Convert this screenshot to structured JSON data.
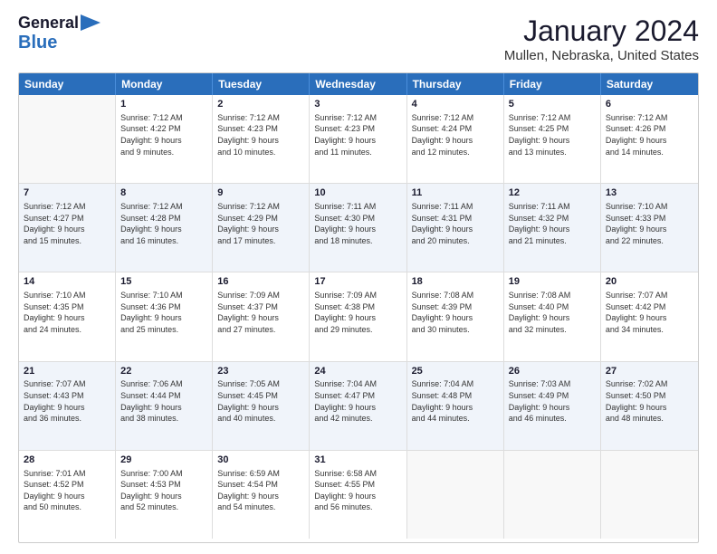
{
  "header": {
    "logo_line1": "General",
    "logo_line2": "Blue",
    "title": "January 2024",
    "subtitle": "Mullen, Nebraska, United States"
  },
  "calendar": {
    "days_of_week": [
      "Sunday",
      "Monday",
      "Tuesday",
      "Wednesday",
      "Thursday",
      "Friday",
      "Saturday"
    ],
    "rows": [
      [
        {
          "day": "",
          "sunrise": "",
          "sunset": "",
          "daylight": "",
          "empty": true
        },
        {
          "day": "1",
          "sunrise": "Sunrise: 7:12 AM",
          "sunset": "Sunset: 4:22 PM",
          "daylight": "Daylight: 9 hours and 9 minutes."
        },
        {
          "day": "2",
          "sunrise": "Sunrise: 7:12 AM",
          "sunset": "Sunset: 4:23 PM",
          "daylight": "Daylight: 9 hours and 10 minutes."
        },
        {
          "day": "3",
          "sunrise": "Sunrise: 7:12 AM",
          "sunset": "Sunset: 4:23 PM",
          "daylight": "Daylight: 9 hours and 11 minutes."
        },
        {
          "day": "4",
          "sunrise": "Sunrise: 7:12 AM",
          "sunset": "Sunset: 4:24 PM",
          "daylight": "Daylight: 9 hours and 12 minutes."
        },
        {
          "day": "5",
          "sunrise": "Sunrise: 7:12 AM",
          "sunset": "Sunset: 4:25 PM",
          "daylight": "Daylight: 9 hours and 13 minutes."
        },
        {
          "day": "6",
          "sunrise": "Sunrise: 7:12 AM",
          "sunset": "Sunset: 4:26 PM",
          "daylight": "Daylight: 9 hours and 14 minutes."
        }
      ],
      [
        {
          "day": "7",
          "sunrise": "Sunrise: 7:12 AM",
          "sunset": "Sunset: 4:27 PM",
          "daylight": "Daylight: 9 hours and 15 minutes."
        },
        {
          "day": "8",
          "sunrise": "Sunrise: 7:12 AM",
          "sunset": "Sunset: 4:28 PM",
          "daylight": "Daylight: 9 hours and 16 minutes."
        },
        {
          "day": "9",
          "sunrise": "Sunrise: 7:12 AM",
          "sunset": "Sunset: 4:29 PM",
          "daylight": "Daylight: 9 hours and 17 minutes."
        },
        {
          "day": "10",
          "sunrise": "Sunrise: 7:11 AM",
          "sunset": "Sunset: 4:30 PM",
          "daylight": "Daylight: 9 hours and 18 minutes."
        },
        {
          "day": "11",
          "sunrise": "Sunrise: 7:11 AM",
          "sunset": "Sunset: 4:31 PM",
          "daylight": "Daylight: 9 hours and 20 minutes."
        },
        {
          "day": "12",
          "sunrise": "Sunrise: 7:11 AM",
          "sunset": "Sunset: 4:32 PM",
          "daylight": "Daylight: 9 hours and 21 minutes."
        },
        {
          "day": "13",
          "sunrise": "Sunrise: 7:10 AM",
          "sunset": "Sunset: 4:33 PM",
          "daylight": "Daylight: 9 hours and 22 minutes."
        }
      ],
      [
        {
          "day": "14",
          "sunrise": "Sunrise: 7:10 AM",
          "sunset": "Sunset: 4:35 PM",
          "daylight": "Daylight: 9 hours and 24 minutes."
        },
        {
          "day": "15",
          "sunrise": "Sunrise: 7:10 AM",
          "sunset": "Sunset: 4:36 PM",
          "daylight": "Daylight: 9 hours and 25 minutes."
        },
        {
          "day": "16",
          "sunrise": "Sunrise: 7:09 AM",
          "sunset": "Sunset: 4:37 PM",
          "daylight": "Daylight: 9 hours and 27 minutes."
        },
        {
          "day": "17",
          "sunrise": "Sunrise: 7:09 AM",
          "sunset": "Sunset: 4:38 PM",
          "daylight": "Daylight: 9 hours and 29 minutes."
        },
        {
          "day": "18",
          "sunrise": "Sunrise: 7:08 AM",
          "sunset": "Sunset: 4:39 PM",
          "daylight": "Daylight: 9 hours and 30 minutes."
        },
        {
          "day": "19",
          "sunrise": "Sunrise: 7:08 AM",
          "sunset": "Sunset: 4:40 PM",
          "daylight": "Daylight: 9 hours and 32 minutes."
        },
        {
          "day": "20",
          "sunrise": "Sunrise: 7:07 AM",
          "sunset": "Sunset: 4:42 PM",
          "daylight": "Daylight: 9 hours and 34 minutes."
        }
      ],
      [
        {
          "day": "21",
          "sunrise": "Sunrise: 7:07 AM",
          "sunset": "Sunset: 4:43 PM",
          "daylight": "Daylight: 9 hours and 36 minutes."
        },
        {
          "day": "22",
          "sunrise": "Sunrise: 7:06 AM",
          "sunset": "Sunset: 4:44 PM",
          "daylight": "Daylight: 9 hours and 38 minutes."
        },
        {
          "day": "23",
          "sunrise": "Sunrise: 7:05 AM",
          "sunset": "Sunset: 4:45 PM",
          "daylight": "Daylight: 9 hours and 40 minutes."
        },
        {
          "day": "24",
          "sunrise": "Sunrise: 7:04 AM",
          "sunset": "Sunset: 4:47 PM",
          "daylight": "Daylight: 9 hours and 42 minutes."
        },
        {
          "day": "25",
          "sunrise": "Sunrise: 7:04 AM",
          "sunset": "Sunset: 4:48 PM",
          "daylight": "Daylight: 9 hours and 44 minutes."
        },
        {
          "day": "26",
          "sunrise": "Sunrise: 7:03 AM",
          "sunset": "Sunset: 4:49 PM",
          "daylight": "Daylight: 9 hours and 46 minutes."
        },
        {
          "day": "27",
          "sunrise": "Sunrise: 7:02 AM",
          "sunset": "Sunset: 4:50 PM",
          "daylight": "Daylight: 9 hours and 48 minutes."
        }
      ],
      [
        {
          "day": "28",
          "sunrise": "Sunrise: 7:01 AM",
          "sunset": "Sunset: 4:52 PM",
          "daylight": "Daylight: 9 hours and 50 minutes."
        },
        {
          "day": "29",
          "sunrise": "Sunrise: 7:00 AM",
          "sunset": "Sunset: 4:53 PM",
          "daylight": "Daylight: 9 hours and 52 minutes."
        },
        {
          "day": "30",
          "sunrise": "Sunrise: 6:59 AM",
          "sunset": "Sunset: 4:54 PM",
          "daylight": "Daylight: 9 hours and 54 minutes."
        },
        {
          "day": "31",
          "sunrise": "Sunrise: 6:58 AM",
          "sunset": "Sunset: 4:55 PM",
          "daylight": "Daylight: 9 hours and 56 minutes."
        },
        {
          "day": "",
          "sunrise": "",
          "sunset": "",
          "daylight": "",
          "empty": true
        },
        {
          "day": "",
          "sunrise": "",
          "sunset": "",
          "daylight": "",
          "empty": true
        },
        {
          "day": "",
          "sunrise": "",
          "sunset": "",
          "daylight": "",
          "empty": true
        }
      ]
    ]
  }
}
